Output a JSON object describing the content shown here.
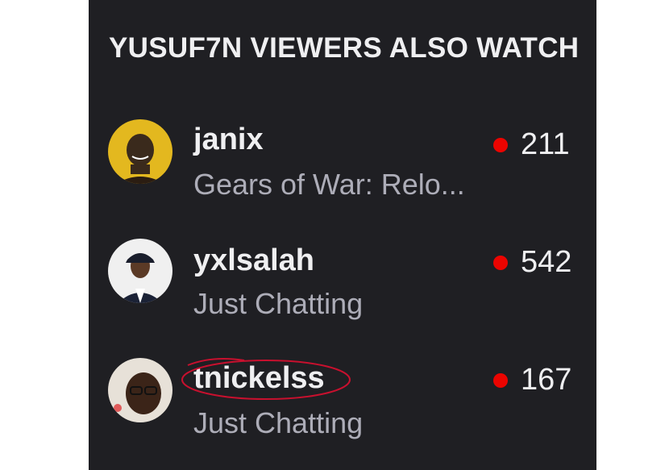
{
  "header": {
    "title": "YUSUF7N VIEWERS ALSO WATCH"
  },
  "colors": {
    "panel_bg": "#1f1f23",
    "live_dot": "#eb0400",
    "highlight_ring": "#c8102e"
  },
  "channels": [
    {
      "name": "janix",
      "category": "Gears of War: Relo...",
      "viewers": "211",
      "avatar_icon": "channel-avatar",
      "status_icon": "live-dot-icon"
    },
    {
      "name": "yxlsalah",
      "category": "Just Chatting",
      "viewers": "542",
      "avatar_icon": "channel-avatar",
      "status_icon": "live-dot-icon"
    },
    {
      "name": "tnickelss",
      "category": "Just Chatting",
      "viewers": "167",
      "avatar_icon": "channel-avatar",
      "status_icon": "live-dot-icon",
      "highlighted": true
    }
  ]
}
